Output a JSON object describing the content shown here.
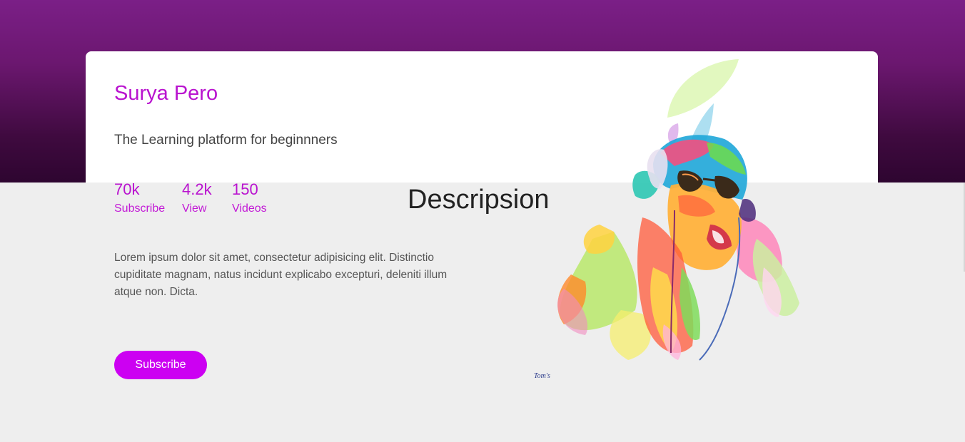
{
  "profile": {
    "name": "Surya Pero",
    "tagline": "The Learning platform for beginnners"
  },
  "stats": [
    {
      "value": "70k",
      "label": "Subscribe"
    },
    {
      "value": "4.2k",
      "label": "View"
    },
    {
      "value": "150",
      "label": "Videos"
    }
  ],
  "description": {
    "heading": "Descripsion",
    "text": "Lorem ipsum dolor sit amet, consectetur adipisicing elit. Distinctio cupiditate magnam, natus incidunt explicabo excepturi, deleniti illum atque non. Dicta."
  },
  "actions": {
    "subscribe_label": "Subscribe"
  },
  "artwork": {
    "signature": "Tom's"
  },
  "colors": {
    "accent": "#b913cf",
    "button": "#cc00f2",
    "header_top": "#7b1f87",
    "header_bottom": "#2e0530",
    "background": "#eeeeee"
  }
}
